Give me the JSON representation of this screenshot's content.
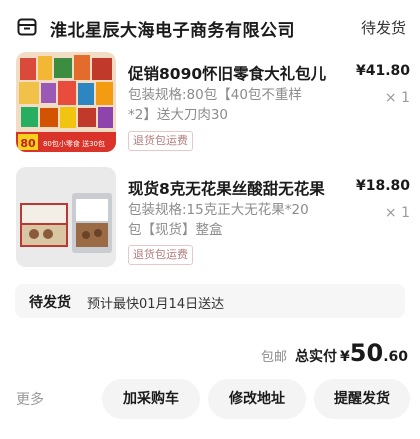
{
  "header": {
    "store_name": "淮北星辰大海电子商务有限公司",
    "status": "待发货"
  },
  "items": [
    {
      "title": "促销8090怀旧零食大礼包儿",
      "price": "¥41.80",
      "spec_line1": "包装规格:80包【40包不重样",
      "spec_line2": "*2】送大刀肉30",
      "qty": "× 1",
      "tag": "退货包运费",
      "thumb_text": "80包小零食 送30包"
    },
    {
      "title": "现货8克无花果丝酸甜无花果",
      "price": "¥18.80",
      "spec_line1": "包装规格:15克正大无花果*20",
      "spec_line2": "包【现货】整盒",
      "qty": "× 1",
      "tag": "退货包运费"
    }
  ],
  "shipping": {
    "label": "待发货",
    "estimate": "预计最快01月14日送达"
  },
  "total": {
    "free_shipping": "包邮",
    "paid_label": "总实付",
    "currency": "¥",
    "amount_int": "50",
    "amount_dec": ".60"
  },
  "actions": {
    "more": "更多",
    "add_to_cart": "加采购车",
    "modify_address": "修改地址",
    "remind_ship": "提醒发货"
  },
  "colors": {
    "text_primary": "#1a1a1a",
    "text_secondary": "#8c8c8c",
    "tag_border": "#e7c8c8",
    "button_bg": "#f4f4f4"
  }
}
